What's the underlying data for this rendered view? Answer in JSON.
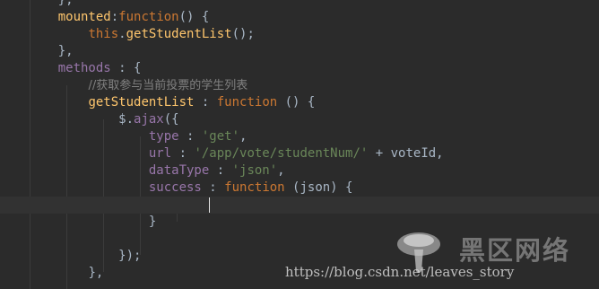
{
  "code_lines": [
    {
      "indent": "    ",
      "tokens": [
        {
          "c": "plain",
          "t": "},"
        }
      ]
    },
    {
      "indent": "    ",
      "tokens": [
        {
          "c": "fn",
          "t": "mounted"
        },
        {
          "c": "plain",
          "t": ":"
        },
        {
          "c": "kw",
          "t": "function"
        },
        {
          "c": "plain",
          "t": "() {"
        }
      ]
    },
    {
      "indent": "        ",
      "tokens": [
        {
          "c": "kw",
          "t": "this"
        },
        {
          "c": "plain",
          "t": "."
        },
        {
          "c": "fn",
          "t": "getStudentList"
        },
        {
          "c": "plain",
          "t": "();"
        }
      ]
    },
    {
      "indent": "    ",
      "tokens": [
        {
          "c": "plain",
          "t": "},"
        }
      ]
    },
    {
      "indent": "    ",
      "tokens": [
        {
          "c": "prop",
          "t": "methods"
        },
        {
          "c": "plain",
          "t": " : {"
        }
      ]
    },
    {
      "indent": "        ",
      "tokens": [
        {
          "c": "cmt",
          "t": "//获取参与当前投票的学生列表"
        }
      ]
    },
    {
      "indent": "        ",
      "tokens": [
        {
          "c": "fn",
          "t": "getStudentList"
        },
        {
          "c": "plain",
          "t": " : "
        },
        {
          "c": "kw",
          "t": "function"
        },
        {
          "c": "plain",
          "t": " () {"
        }
      ]
    },
    {
      "indent": "            ",
      "tokens": [
        {
          "c": "plain",
          "t": "$."
        },
        {
          "c": "prop",
          "t": "ajax"
        },
        {
          "c": "plain",
          "t": "({"
        }
      ]
    },
    {
      "indent": "                ",
      "tokens": [
        {
          "c": "prop",
          "t": "type"
        },
        {
          "c": "plain",
          "t": " : "
        },
        {
          "c": "str",
          "t": "'get'"
        },
        {
          "c": "plain",
          "t": ","
        }
      ]
    },
    {
      "indent": "                ",
      "tokens": [
        {
          "c": "prop",
          "t": "url"
        },
        {
          "c": "plain",
          "t": " : "
        },
        {
          "c": "str",
          "t": "'/app/vote/studentNum/'"
        },
        {
          "c": "plain",
          "t": " + voteId,"
        }
      ]
    },
    {
      "indent": "                ",
      "tokens": [
        {
          "c": "prop",
          "t": "dataType"
        },
        {
          "c": "plain",
          "t": " : "
        },
        {
          "c": "str",
          "t": "'json'"
        },
        {
          "c": "plain",
          "t": ","
        }
      ]
    },
    {
      "indent": "                ",
      "tokens": [
        {
          "c": "prop",
          "t": "success"
        },
        {
          "c": "plain",
          "t": " : "
        },
        {
          "c": "kw",
          "t": "function"
        },
        {
          "c": "plain",
          "t": " (json) {"
        }
      ]
    },
    {
      "indent": "",
      "tokens": []
    },
    {
      "indent": "                ",
      "tokens": [
        {
          "c": "plain",
          "t": "}"
        }
      ]
    },
    {
      "indent": "",
      "tokens": []
    },
    {
      "indent": "            ",
      "tokens": [
        {
          "c": "plain",
          "t": "});"
        }
      ]
    },
    {
      "indent": "        ",
      "tokens": [
        {
          "c": "plain",
          "t": "},"
        }
      ]
    }
  ],
  "watermark": {
    "url_text": "https://blog.csdn.net/leaves_story",
    "site_name": "黑区网络"
  },
  "colors": {
    "background": "#2b2b2b",
    "keyword": "#cc7832",
    "function": "#ffc66d",
    "property": "#9876aa",
    "string": "#6a8759",
    "comment": "#808080",
    "plain": "#a9b7c6"
  }
}
